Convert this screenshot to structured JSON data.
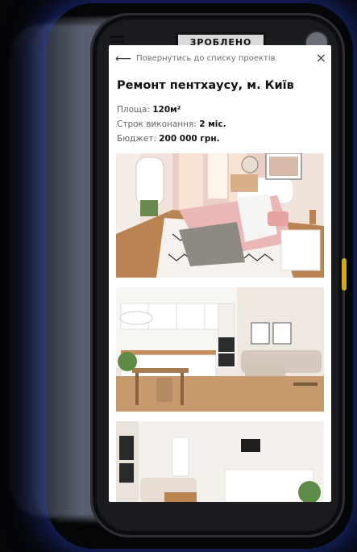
{
  "header": {
    "logo_text": "ЗРОБЛЕНО"
  },
  "modal": {
    "back_label": "Повернутись до списку проектів",
    "close_symbol": "×",
    "title": "Ремонт пентхаусу, м. Київ",
    "facts": {
      "area_label": "Площа:",
      "area_value": "120м²",
      "term_label": "Строк виконання:",
      "term_value": "2 міс.",
      "budget_label": "Бюджет:",
      "budget_value": "200 000 грн."
    },
    "photos": [
      "bedroom-photo",
      "kitchen-living-room-photo",
      "living-room-photo"
    ]
  },
  "colors": {
    "background": "#050608",
    "glow": "#2846c8",
    "accent_yellow": "#d2a81d",
    "modal_bg": "#ffffff"
  }
}
